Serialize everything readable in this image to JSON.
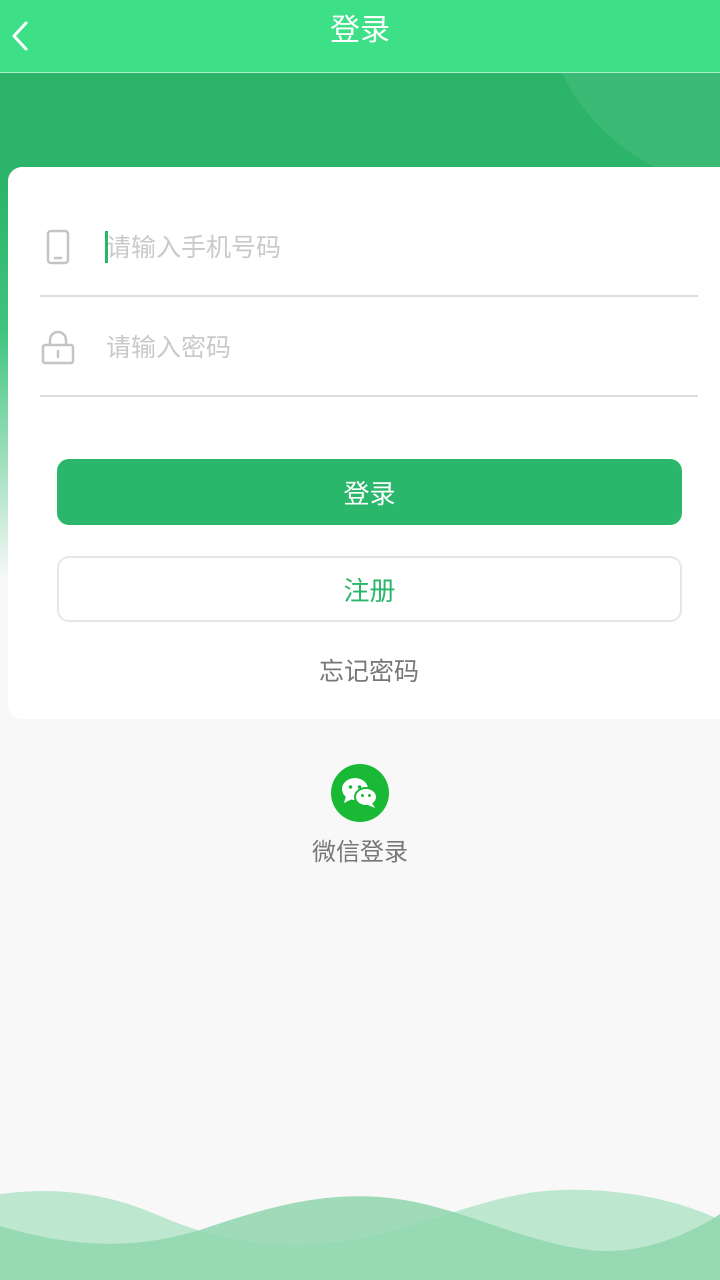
{
  "navbar": {
    "title": "登录",
    "back_icon": "chevron-left-icon"
  },
  "form": {
    "phone": {
      "icon": "phone-icon",
      "placeholder": "请输入手机号码",
      "value": ""
    },
    "password": {
      "icon": "lock-icon",
      "placeholder": "请输入密码",
      "value": ""
    },
    "login_label": "登录",
    "register_label": "注册",
    "forgot_label": "忘记密码"
  },
  "social": {
    "wechat_icon": "wechat-icon",
    "wechat_label": "微信登录"
  },
  "colors": {
    "nav_green": "#3ddf87",
    "primary_green": "#2ab66b",
    "wechat_green": "#19b936",
    "wave_light": "#bde8cf",
    "wave_mid": "#8fd6ae"
  }
}
